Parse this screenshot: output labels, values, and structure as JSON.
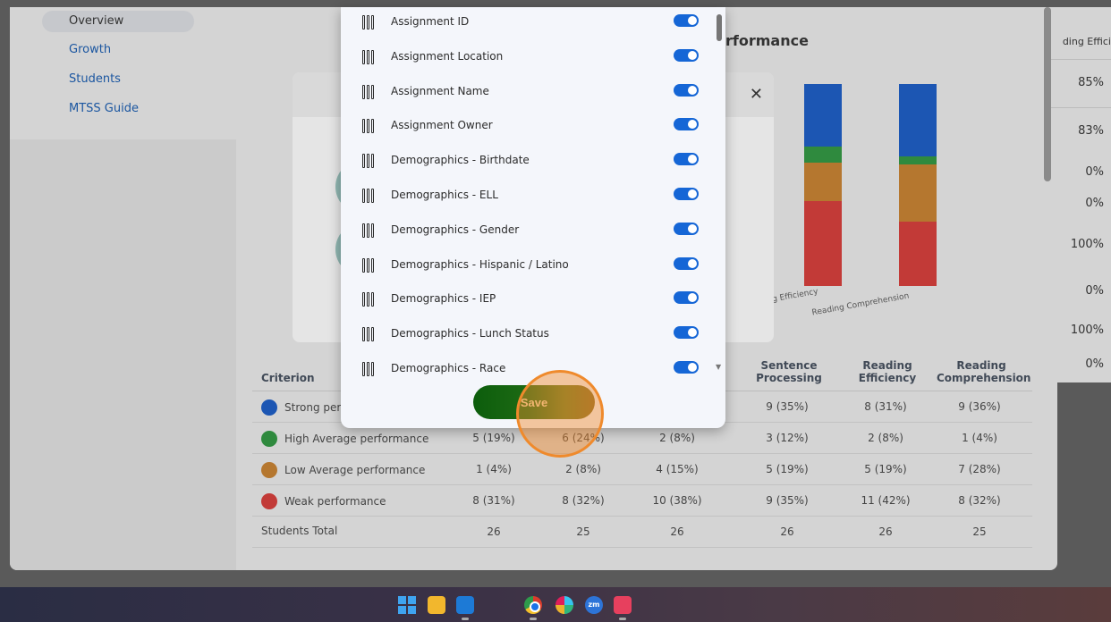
{
  "sidebar": {
    "items": [
      {
        "label": "Overview"
      },
      {
        "label": "Growth"
      },
      {
        "label": "Students"
      },
      {
        "label": "MTSS Guide"
      }
    ]
  },
  "chart_panel": {
    "title_fragment": "rformance",
    "x_labels": [
      "g Efficiency",
      "Reading Comprehension"
    ]
  },
  "chart_data": {
    "type": "bar",
    "stacked": true,
    "categories": [
      "Reading Efficiency",
      "Reading Comprehension"
    ],
    "series": [
      {
        "name": "Weak performance",
        "color": "#c23a37",
        "values": [
          42,
          32
        ]
      },
      {
        "name": "Low Average performance",
        "color": "#b5772f",
        "values": [
          19,
          28
        ]
      },
      {
        "name": "High Average performance",
        "color": "#2f8a3e",
        "values": [
          8,
          4
        ]
      },
      {
        "name": "Strong performance",
        "color": "#1c56b3",
        "values": [
          31,
          36
        ]
      }
    ],
    "ylim": [
      0,
      100
    ]
  },
  "right_column": {
    "header_fragment": "ding Effici",
    "values": [
      "85%",
      "83%",
      "0%",
      "0%",
      "100%",
      "0%",
      "100%",
      "0%"
    ]
  },
  "columns_dialog": {
    "items": [
      {
        "label": "Assignment ID",
        "enabled": true
      },
      {
        "label": "Assignment Location",
        "enabled": true
      },
      {
        "label": "Assignment Name",
        "enabled": true
      },
      {
        "label": "Assignment Owner",
        "enabled": true
      },
      {
        "label": "Demographics - Birthdate",
        "enabled": true
      },
      {
        "label": "Demographics - ELL",
        "enabled": true
      },
      {
        "label": "Demographics - Gender",
        "enabled": true
      },
      {
        "label": "Demographics - Hispanic / Latino",
        "enabled": true
      },
      {
        "label": "Demographics - IEP",
        "enabled": true
      },
      {
        "label": "Demographics - Lunch Status",
        "enabled": true
      },
      {
        "label": "Demographics - Race",
        "enabled": true
      }
    ],
    "save_label": "Save"
  },
  "criteria_table": {
    "headers": {
      "criterion": "Criterion",
      "c4": "Sentence Processing",
      "c5": "Reading Efficiency",
      "c6": "Reading Comprehension"
    },
    "rows": [
      {
        "label": "Strong per",
        "color": "#1c56b3",
        "values": [
          "",
          "",
          "",
          "9 (35%)",
          "8 (31%)",
          "9 (36%)"
        ]
      },
      {
        "label": "High Average performance",
        "color": "#2f8a3e",
        "values": [
          "5 (19%)",
          "6 (24%)",
          "2 (8%)",
          "3 (12%)",
          "2 (8%)",
          "1 (4%)"
        ]
      },
      {
        "label": "Low Average performance",
        "color": "#b5772f",
        "values": [
          "1 (4%)",
          "2 (8%)",
          "4 (15%)",
          "5 (19%)",
          "5 (19%)",
          "7 (28%)"
        ]
      },
      {
        "label": "Weak performance",
        "color": "#c23a37",
        "values": [
          "8 (31%)",
          "8 (32%)",
          "10 (38%)",
          "9 (35%)",
          "11 (42%)",
          "8 (32%)"
        ]
      },
      {
        "label": "Students Total",
        "color": "",
        "values": [
          "26",
          "25",
          "26",
          "26",
          "26",
          "25"
        ]
      }
    ]
  },
  "inner_dialog": {
    "close_glyph": "✕"
  },
  "taskbar": {
    "zoom_label": "zm"
  }
}
